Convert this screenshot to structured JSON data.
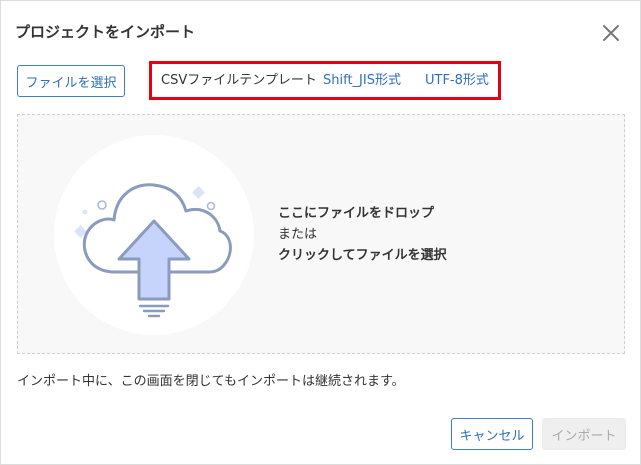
{
  "dialog": {
    "title": "プロジェクトをインポート",
    "close_icon": "close-icon"
  },
  "toolbar": {
    "select_file_label": "ファイルを選択",
    "template_label": "CSVファイルテンプレート",
    "template_links": [
      "Shift_JIS形式",
      "UTF-8形式"
    ]
  },
  "dropzone": {
    "illustration_icon": "cloud-upload-icon",
    "line1": "ここにファイルをドロップ",
    "line2": "または",
    "line3": "クリックしてファイルを選択"
  },
  "notice": "インポート中に、この画面を閉じてもインポートは継続されます。",
  "footer": {
    "cancel_label": "キャンセル",
    "import_label": "インポート",
    "import_disabled": true
  },
  "colors": {
    "accent": "#2e6fb8",
    "highlight_border": "#e60012",
    "arrow_fill": "#c6d3fb",
    "cloud_stroke": "#8a9bbd",
    "disabled_bg": "#efefef"
  }
}
